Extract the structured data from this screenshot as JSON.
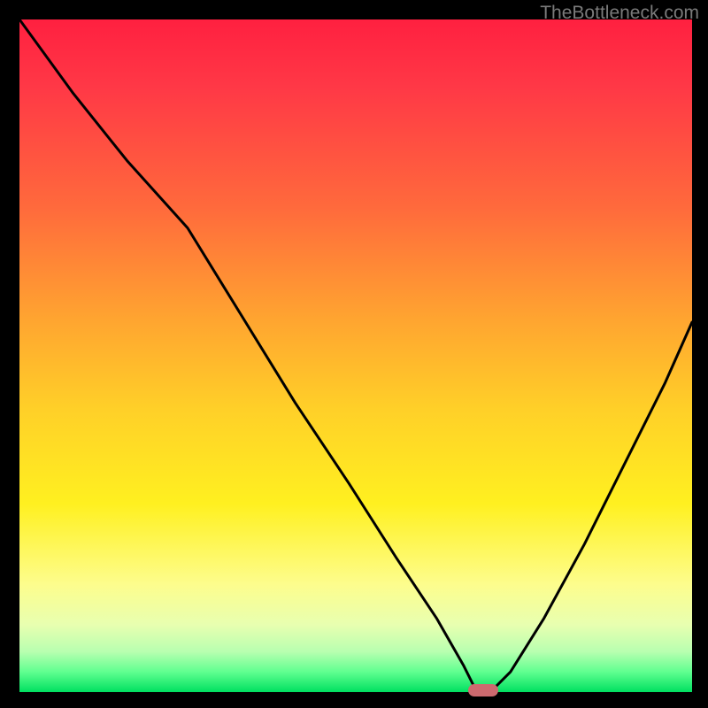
{
  "watermark": "TheBottleneck.com",
  "colors": {
    "background": "#000000",
    "gradient_stops": [
      "#ff2040",
      "#ff3846",
      "#ff6a3c",
      "#ffa630",
      "#ffd028",
      "#fff020",
      "#fdfd8d",
      "#e8ffb0",
      "#b8ffb0",
      "#60ff90",
      "#00e060"
    ],
    "curve": "#000000",
    "marker": "#cd6a6f"
  },
  "chart_data": {
    "type": "line",
    "title": "",
    "xlabel": "",
    "ylabel": "",
    "xlim": [
      0,
      100
    ],
    "ylim": [
      0,
      100
    ],
    "x": [
      0,
      8,
      16,
      25,
      33,
      41,
      49,
      56,
      62,
      66,
      68,
      70,
      73,
      78,
      84,
      90,
      96,
      100
    ],
    "values": [
      100,
      89,
      79,
      69,
      56,
      43,
      31,
      20,
      11,
      4,
      0,
      0,
      3,
      11,
      22,
      34,
      46,
      55
    ],
    "marker": {
      "x": 69,
      "y": 0
    },
    "annotations": []
  }
}
